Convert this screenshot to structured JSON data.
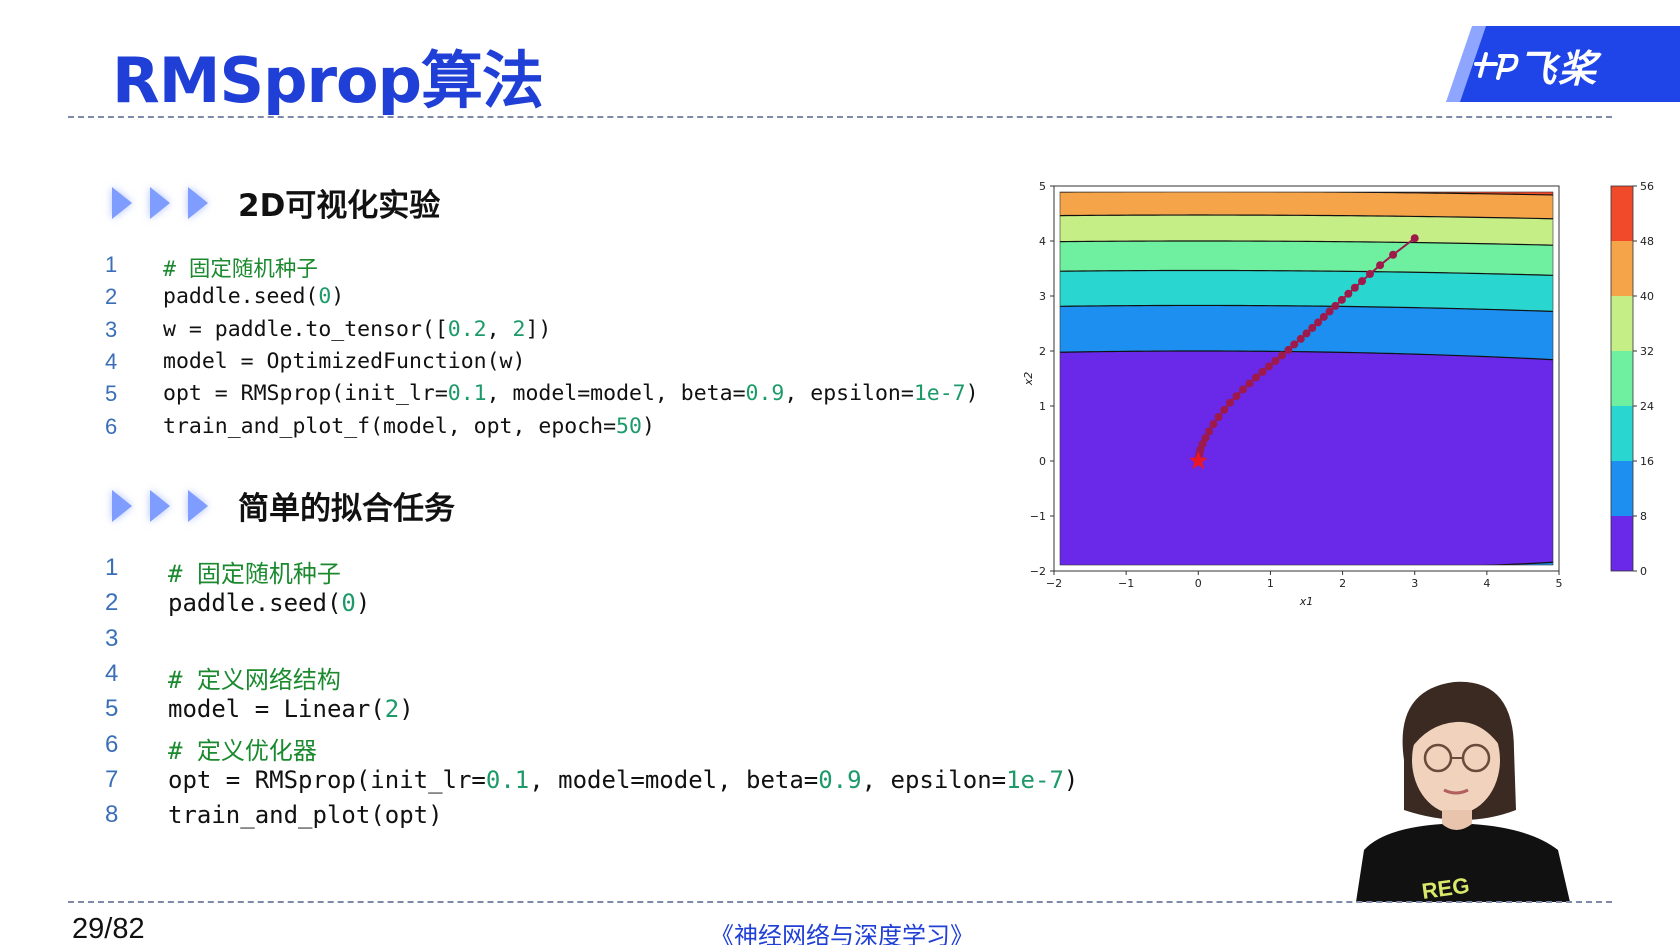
{
  "slide": {
    "title": "RMSprop算法",
    "page_number": "29/82",
    "footer": "《神经网络与深度学习》",
    "logo_text": "飞桨",
    "accent_color": "#1f3fd6"
  },
  "sections": [
    {
      "title": "2D可视化实验",
      "code": [
        {
          "n": "1",
          "parts": [
            {
              "t": "# 固定随机种子",
              "c": "cm"
            }
          ]
        },
        {
          "n": "2",
          "parts": [
            {
              "t": "paddle.seed(",
              "c": ""
            },
            {
              "t": "0",
              "c": "num"
            },
            {
              "t": ")",
              "c": ""
            }
          ]
        },
        {
          "n": "3",
          "parts": [
            {
              "t": "w = paddle.to_tensor([",
              "c": ""
            },
            {
              "t": "0.2",
              "c": "num"
            },
            {
              "t": ", ",
              "c": ""
            },
            {
              "t": "2",
              "c": "num"
            },
            {
              "t": "])",
              "c": ""
            }
          ]
        },
        {
          "n": "4",
          "parts": [
            {
              "t": "model = OptimizedFunction(w)",
              "c": ""
            }
          ]
        },
        {
          "n": "5",
          "parts": [
            {
              "t": "opt = RMSprop(init_lr=",
              "c": ""
            },
            {
              "t": "0.1",
              "c": "num"
            },
            {
              "t": ", model=model, beta=",
              "c": ""
            },
            {
              "t": "0.9",
              "c": "num"
            },
            {
              "t": ", epsilon=",
              "c": ""
            },
            {
              "t": "1e-7",
              "c": "num"
            },
            {
              "t": ")",
              "c": ""
            }
          ]
        },
        {
          "n": "6",
          "parts": [
            {
              "t": "train_and_plot_f(model, opt, epoch=",
              "c": ""
            },
            {
              "t": "50",
              "c": "num"
            },
            {
              "t": ")",
              "c": ""
            }
          ]
        }
      ]
    },
    {
      "title": "简单的拟合任务",
      "code": [
        {
          "n": "1",
          "parts": [
            {
              "t": "# 固定随机种子",
              "c": "cm"
            }
          ]
        },
        {
          "n": "2",
          "parts": [
            {
              "t": "paddle.seed(",
              "c": ""
            },
            {
              "t": "0",
              "c": "num"
            },
            {
              "t": ")",
              "c": ""
            }
          ]
        },
        {
          "n": "3",
          "parts": []
        },
        {
          "n": "4",
          "parts": [
            {
              "t": "# 定义网络结构",
              "c": "cm"
            }
          ]
        },
        {
          "n": "5",
          "parts": [
            {
              "t": "model = Linear(",
              "c": ""
            },
            {
              "t": "2",
              "c": "num"
            },
            {
              "t": ")",
              "c": ""
            }
          ]
        },
        {
          "n": "6",
          "parts": [
            {
              "t": "# 定义优化器",
              "c": "cm"
            }
          ]
        },
        {
          "n": "7",
          "parts": [
            {
              "t": "opt = RMSprop(init_lr=",
              "c": ""
            },
            {
              "t": "0.1",
              "c": "num"
            },
            {
              "t": ", model=model, beta=",
              "c": ""
            },
            {
              "t": "0.9",
              "c": "num"
            },
            {
              "t": ", epsilon=",
              "c": ""
            },
            {
              "t": "1e-7",
              "c": "num"
            },
            {
              "t": ")",
              "c": ""
            }
          ]
        },
        {
          "n": "8",
          "parts": [
            {
              "t": "train_and_plot(opt)",
              "c": ""
            }
          ]
        }
      ]
    }
  ],
  "chart_data": {
    "type": "contour",
    "xlabel": "x1",
    "ylabel": "x2",
    "xlim": [
      -2,
      5
    ],
    "ylim": [
      -2,
      5
    ],
    "x_ticks": [
      "−2",
      "−1",
      "0",
      "1",
      "2",
      "3",
      "4",
      "5"
    ],
    "y_ticks": [
      "−2",
      "−1",
      "0",
      "1",
      "2",
      "3",
      "4",
      "5"
    ],
    "colorbar": {
      "ticks": [
        "0",
        "8",
        "16",
        "24",
        "32",
        "40",
        "48",
        "56"
      ],
      "colors": [
        "#6a28e8",
        "#1d8ff0",
        "#2ad6d0",
        "#6ef0a0",
        "#c6ee86",
        "#f6a44a",
        "#f04a2a"
      ]
    },
    "contour_levels": [
      8,
      16,
      24,
      32,
      40,
      48
    ],
    "start_point": [
      3,
      4
    ],
    "end_point": [
      0,
      0
    ],
    "trajectory": [
      [
        3.0,
        4.05
      ],
      [
        2.7,
        3.75
      ],
      [
        2.52,
        3.56
      ],
      [
        2.38,
        3.4
      ],
      [
        2.27,
        3.27
      ],
      [
        2.17,
        3.15
      ],
      [
        2.08,
        3.04
      ],
      [
        1.99,
        2.93
      ],
      [
        1.9,
        2.82
      ],
      [
        1.82,
        2.72
      ],
      [
        1.74,
        2.62
      ],
      [
        1.66,
        2.52
      ],
      [
        1.58,
        2.42
      ],
      [
        1.5,
        2.32
      ],
      [
        1.42,
        2.22
      ],
      [
        1.33,
        2.12
      ],
      [
        1.25,
        2.02
      ],
      [
        1.16,
        1.92
      ],
      [
        1.07,
        1.82
      ],
      [
        0.98,
        1.72
      ],
      [
        0.89,
        1.62
      ],
      [
        0.8,
        1.52
      ],
      [
        0.71,
        1.41
      ],
      [
        0.62,
        1.3
      ],
      [
        0.53,
        1.18
      ],
      [
        0.44,
        1.06
      ],
      [
        0.36,
        0.93
      ],
      [
        0.28,
        0.8
      ],
      [
        0.21,
        0.67
      ],
      [
        0.15,
        0.54
      ],
      [
        0.1,
        0.42
      ],
      [
        0.06,
        0.31
      ],
      [
        0.03,
        0.21
      ],
      [
        0.015,
        0.13
      ],
      [
        0.006,
        0.07
      ],
      [
        0.0,
        0.02
      ]
    ],
    "trajectory_color": "#9e1a4a",
    "marker_color": "#e8182a"
  }
}
